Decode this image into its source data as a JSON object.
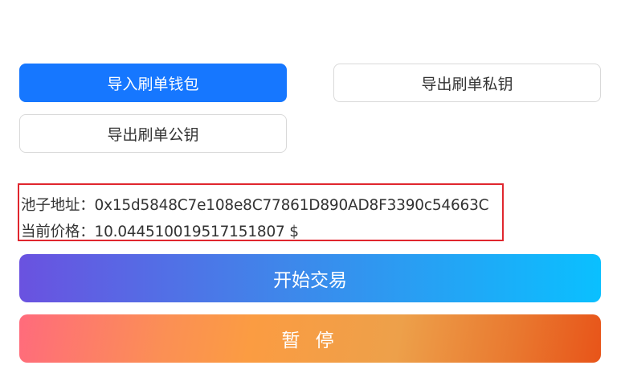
{
  "wallet_actions": {
    "import_label": "导入刷单钱包",
    "export_private_label": "导出刷单私钥",
    "export_public_label": "导出刷单公钥"
  },
  "info": {
    "pool_label": "池子地址：",
    "pool_address": "0x15d5848C7e108e8C77861D890AD8F3390c54663C",
    "price_label": "当前价格：",
    "price_value": "10.044510019517151807 $"
  },
  "trade_actions": {
    "start_label": "开始交易",
    "pause_label": "暂 停"
  },
  "colors": {
    "primary": "#1677ff",
    "highlight_border": "#e0262e",
    "start_gradient": [
      "#6a52e0",
      "#0ac0ff"
    ],
    "pause_gradient": [
      "#ff6b7c",
      "#e85419"
    ]
  }
}
